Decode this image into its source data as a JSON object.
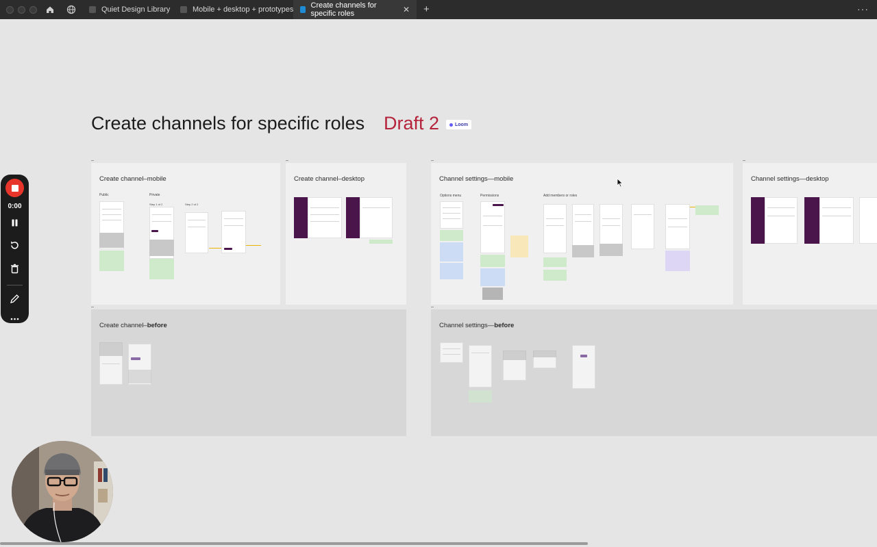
{
  "tabs": [
    {
      "label": "Quiet Design Library"
    },
    {
      "label": "Mobile + desktop + prototypes"
    },
    {
      "label": "Create channels for specific roles",
      "close": "✕"
    }
  ],
  "toolbar": {
    "new_tab": "+",
    "more": "···"
  },
  "page": {
    "title": "Create channels for specific roles",
    "draft": "Draft 2",
    "badge": "Loom"
  },
  "frames": {
    "create_mobile": {
      "title": "Create channel–mobile",
      "labels": [
        "Public",
        "Private",
        "Step 1 of 2",
        "Step 2 of 2"
      ]
    },
    "create_desktop": {
      "title": "Create channel–desktop"
    },
    "settings_mobile": {
      "title": "Channel settings—mobile",
      "labels": [
        "Options menu",
        "Permissions",
        "Add members or roles"
      ]
    },
    "settings_desktop": {
      "title": "Channel settings—desktop"
    },
    "create_before": {
      "title_prefix": "Create channel–",
      "title_bold": "before"
    },
    "settings_before": {
      "title_prefix": "Channel settings—",
      "title_bold": "before"
    }
  },
  "recorder": {
    "time": "0:00"
  },
  "colors": {
    "accent_red": "#b5233b",
    "brand_purple": "#4a154b",
    "record_red": "#e8352b"
  }
}
